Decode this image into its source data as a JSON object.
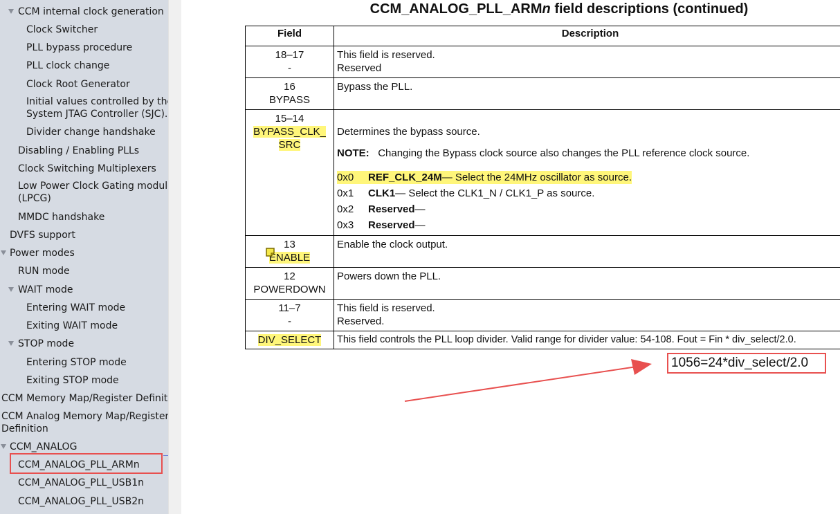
{
  "sidebar": {
    "items": [
      {
        "label": "CCM internal clock generation",
        "expanded": true
      },
      {
        "label": "Clock Switcher"
      },
      {
        "label": "PLL bypass procedure"
      },
      {
        "label": "PLL clock change"
      },
      {
        "label": "Clock Root Generator"
      },
      {
        "label": "Initial values controlled by the System JTAG Controller (SJC)."
      },
      {
        "label": "Divider change handshake"
      },
      {
        "label": "Disabling / Enabling PLLs"
      },
      {
        "label": "Clock Switching Multiplexers"
      },
      {
        "label": "Low Power Clock Gating module (LPCG)"
      },
      {
        "label": "MMDC handshake"
      },
      {
        "label": "DVFS support"
      },
      {
        "label": "Power modes",
        "expanded": true
      },
      {
        "label": "RUN mode"
      },
      {
        "label": "WAIT mode",
        "expanded": true
      },
      {
        "label": "Entering WAIT mode"
      },
      {
        "label": "Exiting WAIT mode"
      },
      {
        "label": "STOP mode",
        "expanded": true
      },
      {
        "label": "Entering STOP mode"
      },
      {
        "label": "Exiting STOP mode"
      },
      {
        "label": "CCM Memory Map/Register Definit"
      },
      {
        "label": "CCM Analog Memory Map/Register Definition"
      },
      {
        "label": "CCM_ANALOG",
        "expanded": true
      },
      {
        "label": "CCM_ANALOG_PLL_ARMn",
        "selected": true
      },
      {
        "label": "CCM_ANALOG_PLL_USB1n"
      },
      {
        "label": "CCM_ANALOG_PLL_USB2n"
      }
    ]
  },
  "table": {
    "title_prefix": "CCM_ANALOG_PLL_ARM",
    "title_italic": "n",
    "title_suffix": " field descriptions (continued)",
    "headers": {
      "field": "Field",
      "description": "Description"
    },
    "rows": [
      {
        "bits": "18–17",
        "name": "-",
        "desc": "This field is reserved.",
        "desc2": "Reserved"
      },
      {
        "bits": "16",
        "name": "BYPASS",
        "desc": "Bypass the PLL."
      },
      {
        "bits": "15–14",
        "name_line1": "BYPASS_CLK_",
        "name_line2": "SRC",
        "desc": "Determines the bypass source.",
        "note_label": "NOTE:",
        "note_text": "Changing the Bypass clock source also changes the PLL reference clock source.",
        "values": [
          {
            "code": "0x0",
            "name": "REF_CLK_24M",
            "text": " — Select the 24MHz oscillator as source."
          },
          {
            "code": "0x1",
            "name": "CLK1",
            "text": " — Select the CLK1_N / CLK1_P as source."
          },
          {
            "code": "0x2",
            "name": "Reserved",
            "text": " —"
          },
          {
            "code": "0x3",
            "name": "Reserved",
            "text": " —"
          }
        ]
      },
      {
        "bits": "13",
        "name": "ENABLE",
        "desc": "Enable the clock output."
      },
      {
        "bits": "12",
        "name": "POWERDOWN",
        "desc": "Powers down the PLL."
      },
      {
        "bits": "11–7",
        "name": "-",
        "desc": "This field is reserved.",
        "desc2": "Reserved."
      },
      {
        "name": "DIV_SELECT",
        "desc": "This field controls the PLL loop divider. Valid range for divider value: 54-108. Fout = Fin * div_select/2.0."
      }
    ]
  },
  "annotation": {
    "text": "1056=24*div_select/2.0",
    "color": "#e8504f"
  },
  "colors": {
    "highlight": "#fff67a",
    "annotation_red": "#e8504f",
    "sidebar_bg": "#d6dbe3"
  }
}
